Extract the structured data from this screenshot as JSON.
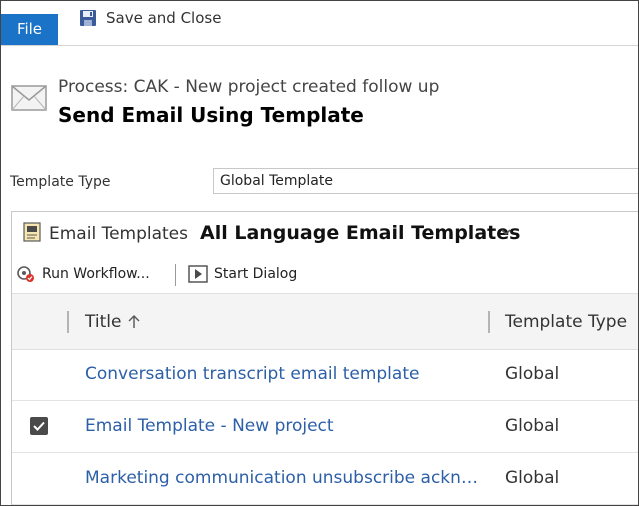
{
  "ribbon": {
    "file_label": "File",
    "save_close_label": "Save and Close"
  },
  "header": {
    "process_label": "Process: CAK - New project created follow up",
    "title": "Send Email Using Template"
  },
  "template_type": {
    "label": "Template Type",
    "value": "Global Template"
  },
  "grid": {
    "entity_label": "Email Templates",
    "view_name": "All Language Email Templates",
    "commands": {
      "run_workflow": "Run Workflow...",
      "start_dialog": "Start Dialog"
    },
    "columns": {
      "title": "Title",
      "template_type": "Template Type"
    },
    "rows": [
      {
        "title": "Conversation transcript email template",
        "type": "Global",
        "selected": false
      },
      {
        "title": "Email Template - New project",
        "type": "Global",
        "selected": true
      },
      {
        "title": "Marketing communication unsubscribe acknowledgement",
        "type": "Global",
        "selected": false
      }
    ]
  },
  "colors": {
    "file_tab": "#1a73c7",
    "link": "#2c5fa8"
  }
}
